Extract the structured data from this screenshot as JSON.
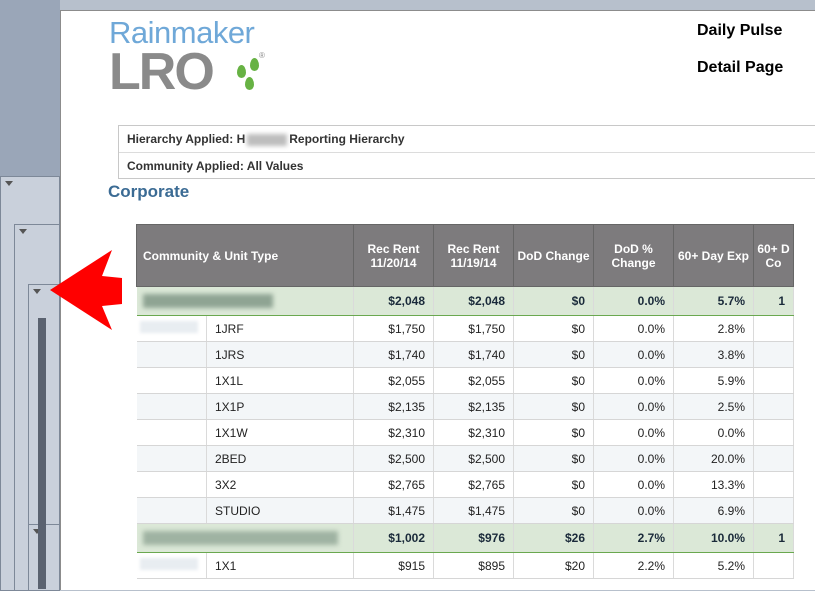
{
  "logo": {
    "top": "Rainmaker",
    "bottom": "LRO",
    "reg": "®"
  },
  "header": {
    "title": "Daily Pulse",
    "subtitle": "Detail Page"
  },
  "filters": {
    "hierarchy_label": "Hierarchy Applied: H",
    "hierarchy_suffix": "Reporting Hierarchy",
    "community_label": "Community Applied: All Values"
  },
  "section_title": "Corporate",
  "table": {
    "columns": [
      "Community & Unit Type",
      "Rec Rent 11/20/14",
      "Rec Rent 11/19/14",
      "DoD Change",
      "DoD % Change",
      "60+ Day Exp",
      "60+ D Co"
    ],
    "summary1": {
      "rec1": "$2,048",
      "rec2": "$2,048",
      "dod": "$0",
      "dodp": "0.0%",
      "exp": "5.7%",
      "next": "1"
    },
    "rows1": [
      {
        "unit": "1JRF",
        "rec1": "$1,750",
        "rec2": "$1,750",
        "dod": "$0",
        "dodp": "0.0%",
        "exp": "2.8%"
      },
      {
        "unit": "1JRS",
        "rec1": "$1,740",
        "rec2": "$1,740",
        "dod": "$0",
        "dodp": "0.0%",
        "exp": "3.8%"
      },
      {
        "unit": "1X1L",
        "rec1": "$2,055",
        "rec2": "$2,055",
        "dod": "$0",
        "dodp": "0.0%",
        "exp": "5.9%"
      },
      {
        "unit": "1X1P",
        "rec1": "$2,135",
        "rec2": "$2,135",
        "dod": "$0",
        "dodp": "0.0%",
        "exp": "2.5%"
      },
      {
        "unit": "1X1W",
        "rec1": "$2,310",
        "rec2": "$2,310",
        "dod": "$0",
        "dodp": "0.0%",
        "exp": "0.0%"
      },
      {
        "unit": "2BED",
        "rec1": "$2,500",
        "rec2": "$2,500",
        "dod": "$0",
        "dodp": "0.0%",
        "exp": "20.0%"
      },
      {
        "unit": "3X2",
        "rec1": "$2,765",
        "rec2": "$2,765",
        "dod": "$0",
        "dodp": "0.0%",
        "exp": "13.3%"
      },
      {
        "unit": "STUDIO",
        "rec1": "$1,475",
        "rec2": "$1,475",
        "dod": "$0",
        "dodp": "0.0%",
        "exp": "6.9%"
      }
    ],
    "summary2": {
      "rec1": "$1,002",
      "rec2": "$976",
      "dod": "$26",
      "dodp": "2.7%",
      "exp": "10.0%",
      "next": "1"
    },
    "rows2": [
      {
        "unit": "1X1",
        "rec1": "$915",
        "rec2": "$895",
        "dod": "$20",
        "dodp": "2.2%",
        "exp": "5.2%"
      }
    ]
  },
  "colors": {
    "header_bg": "#7d7b7d",
    "summary_bg": "#dbe8d7",
    "accent": "#3b6b94",
    "arrow": "#ff0000"
  }
}
